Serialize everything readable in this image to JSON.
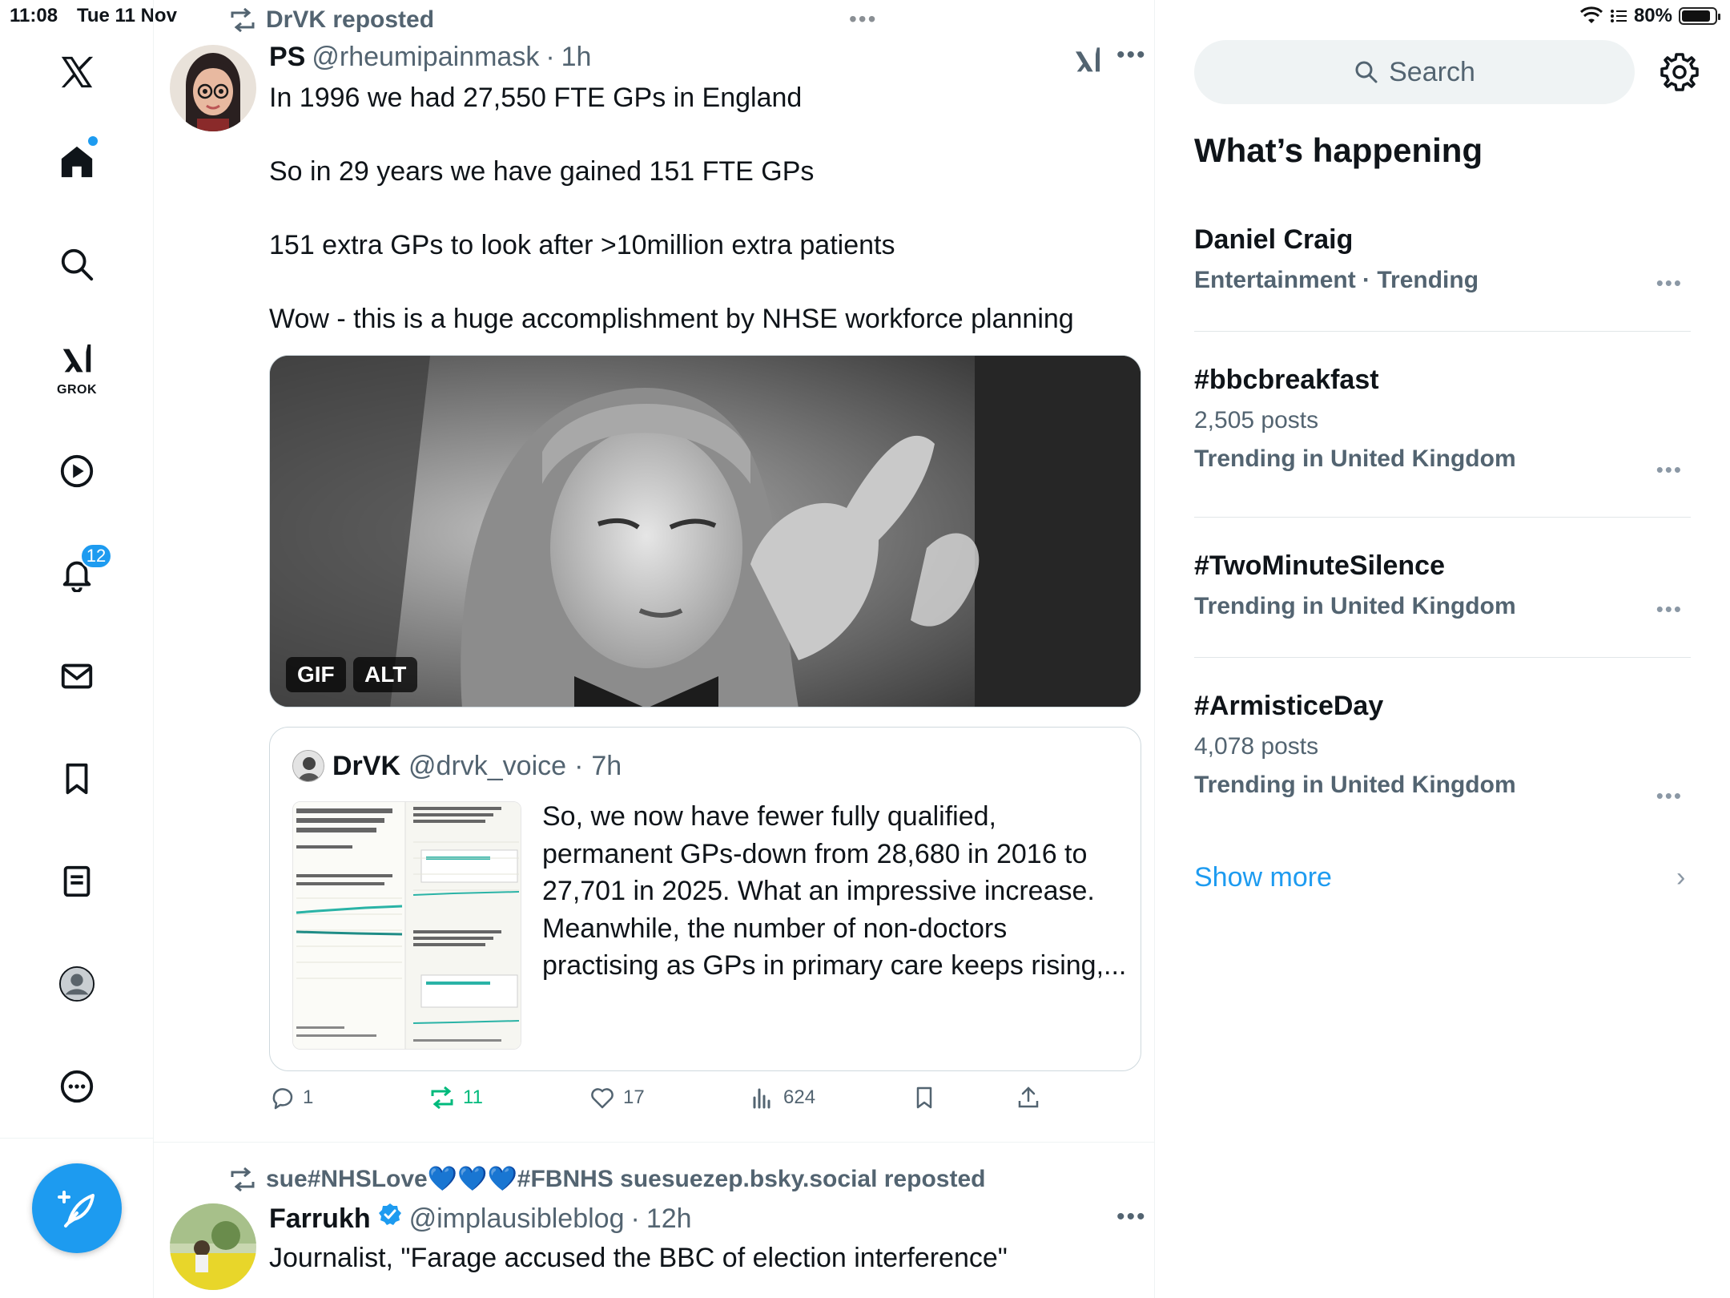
{
  "status_bar": {
    "time": "11:08",
    "date": "Tue 11 Nov",
    "battery": "80%"
  },
  "nav": {
    "notifications_count": "12",
    "grok_label": "GROK"
  },
  "tweet1": {
    "repost_by": "DrVK reposted",
    "name": "PS",
    "handle": "@rheumipainmask",
    "separator": "·",
    "time": "1h",
    "text": [
      "In 1996 we had 27,550 FTE GPs in England",
      "So in 29 years we have gained 151 FTE GPs",
      "151 extra GPs to look after >10million extra patients",
      "Wow - this is a huge accomplishment by NHSE workforce planning"
    ],
    "media_badges": [
      "GIF",
      "ALT"
    ],
    "quote": {
      "name": "DrVK",
      "handle": "@drvk_voice",
      "separator": "·",
      "time": "7h",
      "text": "So, we now have fewer fully qualified, permanent GPs-down from 28,680 in 2016 to 27,701 in 2025. What an impressive increase. Meanwhile, the number of non-doctors practising as GPs in primary care keeps rising,..."
    },
    "stats": {
      "replies": "1",
      "reposts": "11",
      "likes": "17",
      "views": "624"
    }
  },
  "tweet2": {
    "repost_by": "sue#NHSLove💙💙💙#FBNHS suesuezep.bsky.social reposted",
    "name": "Farrukh",
    "handle": "@implausibleblog",
    "separator": "·",
    "time": "12h",
    "text": "Journalist, \"Farage accused the  BBC of election interference\""
  },
  "sidebar": {
    "search_placeholder": "Search",
    "section_title": "What’s happening",
    "trends": [
      {
        "title": "Daniel Craig",
        "meta": "",
        "sub": "Entertainment · Trending"
      },
      {
        "title": "#bbcbreakfast",
        "meta": "2,505 posts",
        "sub": "Trending in United Kingdom"
      },
      {
        "title": "#TwoMinuteSilence",
        "meta": "",
        "sub": "Trending in United Kingdom"
      },
      {
        "title": "#ArmisticeDay",
        "meta": "4,078 posts",
        "sub": "Trending in United Kingdom"
      }
    ],
    "show_more": "Show more"
  },
  "colors": {
    "accent": "#1d9bf0",
    "repost_green": "#00ba7c",
    "secondary_text": "#536471"
  }
}
